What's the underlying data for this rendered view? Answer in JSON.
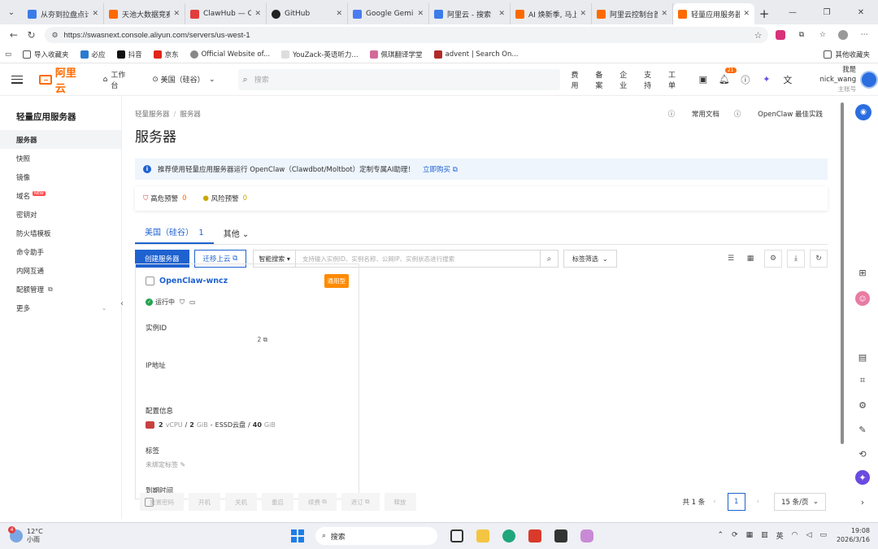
{
  "browser": {
    "tabs": [
      {
        "label": "从夯到拉盘点计",
        "color": "#3b7be8"
      },
      {
        "label": "天池大数据竞赛",
        "color": "#ff6a00"
      },
      {
        "label": "ClawHub — Cl",
        "color": "#e23d3d"
      },
      {
        "label": "GitHub",
        "color": "#222222"
      },
      {
        "label": "Google Gemini",
        "color": "#4a7cf0"
      },
      {
        "label": "阿里云 - 搜索",
        "color": "#3b7be8"
      },
      {
        "label": "AI 焕新季, 马上",
        "color": "#ff6a00"
      },
      {
        "label": "阿里云控制台首",
        "color": "#ff6a00"
      },
      {
        "label": "轻量应用服务器",
        "color": "#ff6a00"
      }
    ],
    "url": "https://swasnext.console.aliyun.com/servers/us-west-1"
  },
  "bookmarks": {
    "items": [
      "导入收藏夹",
      "必应",
      "抖音",
      "京东",
      "Official Website of...",
      "YouZack-英语听力...",
      "佩琪翻译学堂",
      "advent | Search On..."
    ],
    "other": "其他收藏夹"
  },
  "header": {
    "logo": "阿里云",
    "workbench": "工作台",
    "region": "美国（硅谷）",
    "search_placeholder": "搜索",
    "links": [
      "费用",
      "备案",
      "企业",
      "支持",
      "工单"
    ],
    "notif_count": "21",
    "user_name": "我是nick_wang",
    "user_role": "主账号"
  },
  "sidebar": {
    "title": "轻量应用服务器",
    "items": [
      {
        "label": "服务器",
        "active": true
      },
      {
        "label": "快照"
      },
      {
        "label": "镜像"
      },
      {
        "label": "域名",
        "badge": "NEW"
      },
      {
        "label": "密钥对"
      },
      {
        "label": "防火墙模板"
      },
      {
        "label": "命令助手"
      },
      {
        "label": "内网互通"
      },
      {
        "label": "配额管理"
      },
      {
        "label": "更多"
      }
    ]
  },
  "main": {
    "breadcrumb": [
      "轻量服务器",
      "服务器"
    ],
    "doc_links": [
      "常用文档",
      "OpenClaw 最佳实践"
    ],
    "title": "服务器",
    "notice": "推荐使用轻量应用服务器运行 OpenClaw（Clawdbot/Moltbot）定制专属AI助理！",
    "notice_link": "立即购买",
    "alerts": [
      {
        "label": "高危预警",
        "count": "0"
      },
      {
        "label": "风险预警",
        "count": "0"
      }
    ],
    "tabs": [
      {
        "label": "美国（硅谷）",
        "count": "1"
      },
      {
        "label": "其他"
      }
    ],
    "toolbar": {
      "create": "创建服务器",
      "migrate": "迁移上云",
      "search_type": "智能搜索",
      "search_placeholder": "支持输入实例ID、实例名称、公网IP、实例状态进行搜索",
      "tag_filter": "标签筛选"
    },
    "card": {
      "name": "OpenClaw-wncz",
      "tag": "通用型",
      "status": "运行中",
      "instance_id_label": "实例ID",
      "instance_id_value": "2",
      "ip_label": "IP地址",
      "config_label": "配置信息",
      "config": {
        "vcpu": "2",
        "vcpu_unit": "vCPU",
        "mem": "2",
        "mem_unit": "GiB",
        "disk_type": "ESSD云盘",
        "disk": "40",
        "disk_unit": "GiB"
      },
      "tags_label": "标签",
      "tags_value": "未绑定标签",
      "expire_label": "到期时间"
    },
    "bulk_buttons": [
      "重置密码",
      "开机",
      "关机",
      "重启",
      "续费",
      "退订",
      "释放"
    ],
    "pager": {
      "total": "共 1 条",
      "page": "1",
      "size": "15 条/页"
    }
  },
  "taskbar": {
    "weather_temp": "12°C",
    "weather_desc": "小雨",
    "weather_badge": "4",
    "search": "搜索",
    "ime": "英",
    "time": "19:08",
    "date": "2026/3/16"
  }
}
